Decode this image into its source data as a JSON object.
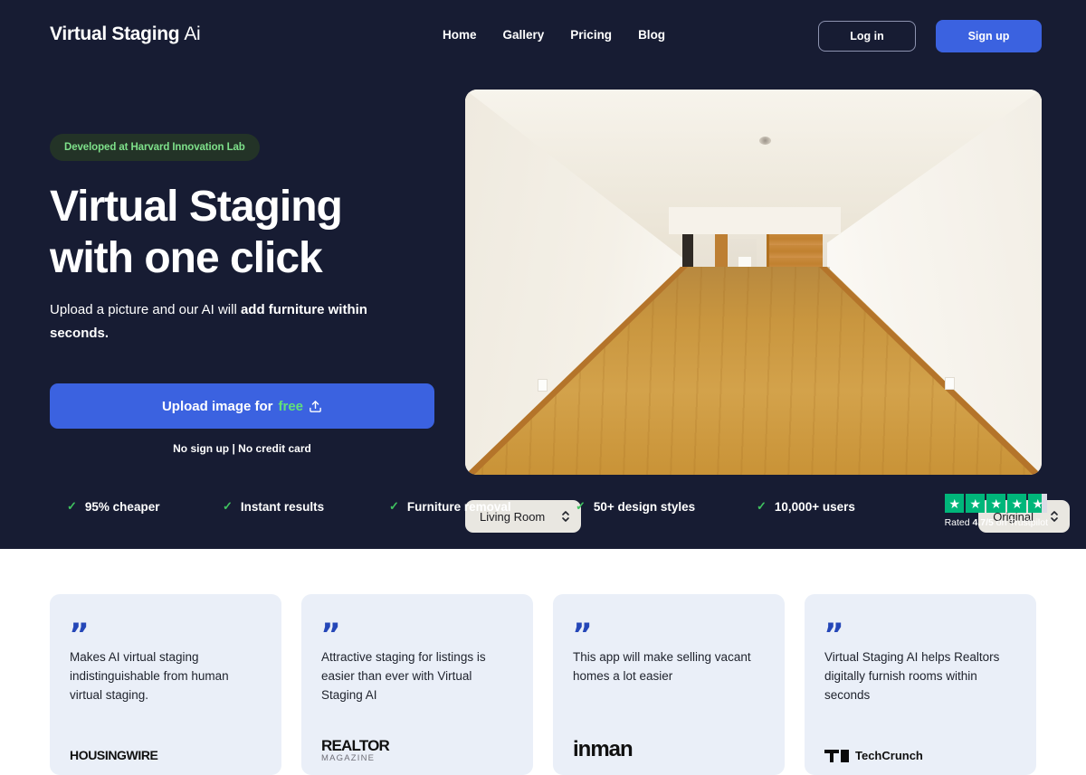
{
  "brand": {
    "name_bold": "Virtual Staging",
    "name_light": "Ai",
    "accent_blue": "#3b62e0",
    "accent_green": "#61e07a",
    "dark_bg": "#171c33"
  },
  "nav": {
    "links": [
      {
        "label": "Home"
      },
      {
        "label": "Gallery"
      },
      {
        "label": "Pricing"
      },
      {
        "label": "Blog"
      }
    ],
    "login_label": "Log in",
    "signup_label": "Sign up"
  },
  "hero": {
    "badge": "Developed at Harvard Innovation Lab",
    "headline_line1": "Virtual Staging",
    "headline_line2": "with one click",
    "subhead_plain": "Upload a picture and our AI will ",
    "subhead_bold": "add furniture within seconds.",
    "cta_label": "Upload image for ",
    "cta_free": "free",
    "cta_icon": "upload-icon",
    "cta_sub": "No sign up | No credit card",
    "image_alt": "empty-room-photo",
    "room_select_value": "Living Room",
    "style_select_value": "Original"
  },
  "features": [
    {
      "label": "95% cheaper"
    },
    {
      "label": "Instant results"
    },
    {
      "label": "Furniture removal"
    },
    {
      "label": "50+ design styles"
    },
    {
      "label": "10,000+ users"
    }
  ],
  "trustpilot": {
    "stars_total": 5,
    "stars_filled": 4,
    "partial_fraction": 0.7,
    "star_color": "#00b67a",
    "rating_prefix": "Rated ",
    "rating_value": "4.7/5",
    "rating_suffix": " on Trustpilot"
  },
  "testimonials": [
    {
      "quote": "Makes AI virtual staging indistinguishable from human virtual staging.",
      "source": "HOUSINGWIRE"
    },
    {
      "quote": "Attractive staging for listings is easier than ever with Virtual Staging AI",
      "source": "REALTOR",
      "source_sub": "MAGAZINE"
    },
    {
      "quote": "This app will make selling vacant homes a lot easier",
      "source": "inman"
    },
    {
      "quote": "Virtual Staging AI helps Realtors digitally furnish rooms within seconds",
      "source": "TechCrunch"
    }
  ]
}
